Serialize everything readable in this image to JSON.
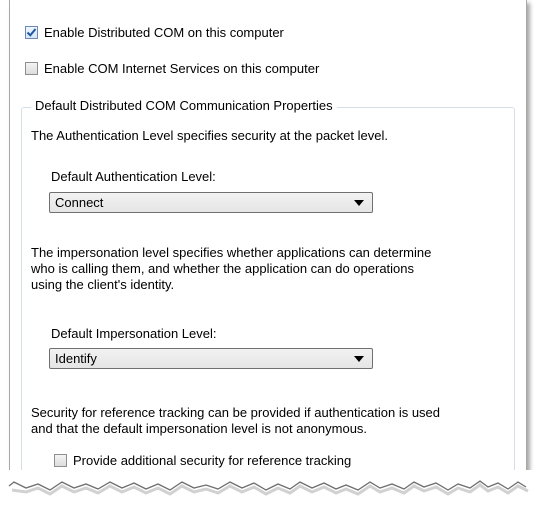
{
  "checkboxes": {
    "enable_dcom": {
      "label": "Enable Distributed COM on this computer",
      "checked": true
    },
    "enable_cis": {
      "label": "Enable COM Internet Services on this computer",
      "checked": false
    }
  },
  "group": {
    "title": "Default Distributed COM Communication Properties",
    "auth_desc": "The Authentication Level specifies security at the packet level.",
    "auth_label": "Default Authentication Level:",
    "auth_value": "Connect",
    "imp_desc_1": "The impersonation level specifies whether applications can determine",
    "imp_desc_2": "who is calling them, and whether the application can do operations",
    "imp_desc_3": "using the client's identity.",
    "imp_label": "Default Impersonation Level:",
    "imp_value": "Identify",
    "ref_desc_1": "Security for reference tracking can be provided if authentication is used",
    "ref_desc_2": "and that the default impersonation level is not anonymous.",
    "ref_checkbox": {
      "label": "Provide additional security for reference tracking",
      "checked": false
    }
  },
  "colors": {
    "accent": "#1e57a4",
    "group_border": "#d5dfe5"
  }
}
